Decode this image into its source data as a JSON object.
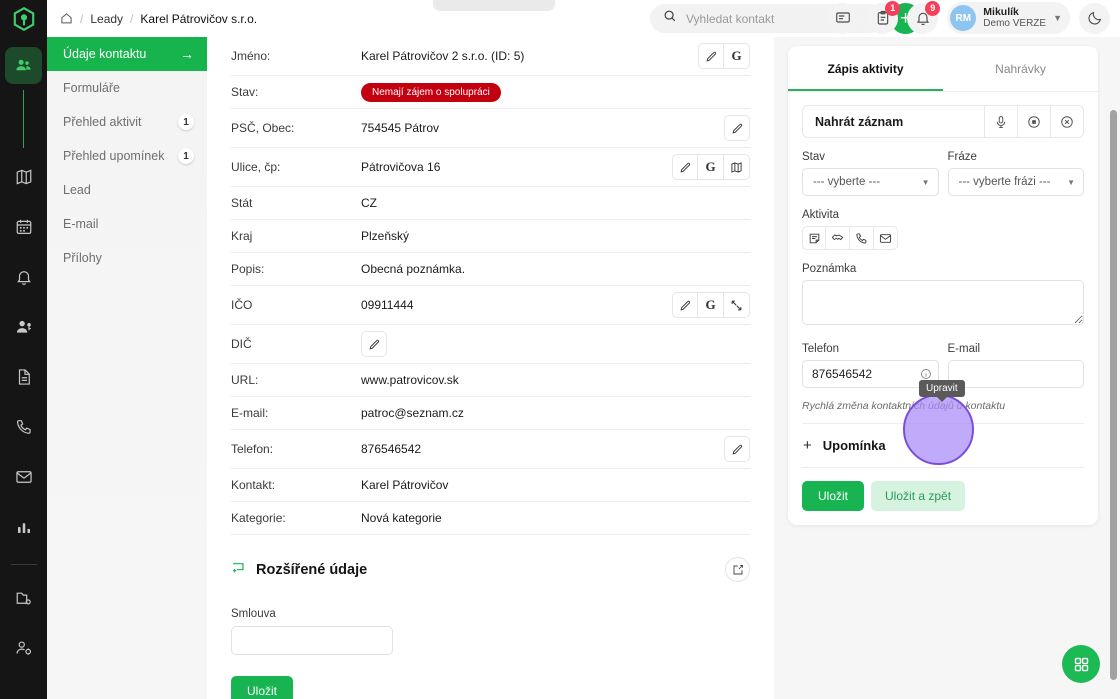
{
  "topbar": {
    "breadcrumb": {
      "home_icon": "home-icon",
      "items": [
        "Leady",
        "Karel Pátrovičov s.r.o."
      ],
      "separator": "/"
    },
    "search": {
      "placeholder": "Vyhledat kontakt",
      "value": "",
      "icon": "search-icon"
    },
    "add_button_label": "+",
    "actions": [
      {
        "name": "chat-icon",
        "badge": ""
      },
      {
        "name": "clipboard-icon",
        "badge": "1"
      },
      {
        "name": "bell-icon",
        "badge": "9"
      }
    ],
    "user": {
      "initials": "RM",
      "name": "Mikulík",
      "subtitle": "Demo VERZE"
    },
    "theme_toggle_icon": "moon-icon"
  },
  "rail": {
    "logo_icon": "app-logo-icon",
    "items": [
      {
        "name": "contacts-icon",
        "active": true
      },
      {
        "name": "map-icon",
        "active": false
      },
      {
        "name": "calendar-icon",
        "active": false
      },
      {
        "name": "bell-icon",
        "active": false
      },
      {
        "name": "user-key-icon",
        "active": false
      },
      {
        "name": "document-icon",
        "active": false
      },
      {
        "name": "phone-icon",
        "active": false
      },
      {
        "name": "mail-icon",
        "active": false
      },
      {
        "name": "chart-icon",
        "active": false
      },
      {
        "name": "folder-settings-icon",
        "active": false
      },
      {
        "name": "user-settings-icon",
        "active": false
      }
    ]
  },
  "subnav": {
    "items": [
      {
        "label": "Údaje kontaktu",
        "active": true,
        "badge": "",
        "arrow": "→"
      },
      {
        "label": "Formuláře",
        "active": false,
        "badge": ""
      },
      {
        "label": "Přehled aktivit",
        "active": false,
        "badge": "1"
      },
      {
        "label": "Přehled upomínek",
        "active": false,
        "badge": "1"
      },
      {
        "label": "Lead",
        "active": false,
        "badge": ""
      },
      {
        "label": "E-mail",
        "active": false,
        "badge": ""
      },
      {
        "label": "Přílohy",
        "active": false,
        "badge": ""
      }
    ]
  },
  "detail": {
    "rows": [
      {
        "label": "Jméno:",
        "value": "Karel Pátrovičov 2 s.r.o. (ID: 5)",
        "type": "text",
        "actions": [
          "edit-icon",
          "google-icon"
        ]
      },
      {
        "label": "Stav:",
        "value": "Nemají zájem o spolupráci",
        "type": "badge",
        "badge_color": "#c30010",
        "actions": []
      },
      {
        "label": "PSČ, Obec:",
        "value": "754545 Pátrov",
        "type": "text",
        "actions": [
          "edit-icon"
        ]
      },
      {
        "label": "Ulice, čp:",
        "value": "Pátrovičova 16",
        "type": "text",
        "actions": [
          "edit-icon",
          "google-icon",
          "map-icon"
        ]
      },
      {
        "label": "Stát",
        "value": "CZ",
        "type": "text",
        "actions": []
      },
      {
        "label": "Kraj",
        "value": "Plzeňský",
        "type": "text",
        "actions": []
      },
      {
        "label": "Popis:",
        "value": "Obecná poznámka.",
        "type": "text",
        "actions": []
      },
      {
        "label": "IČO",
        "value": "09911444",
        "type": "text",
        "actions": [
          "edit-icon",
          "google-icon",
          "ares-icon"
        ]
      },
      {
        "label": "DIČ",
        "value": "",
        "type": "text",
        "actions": [
          "edit-icon"
        ]
      },
      {
        "label": "URL:",
        "value": "www.patrovicov.sk",
        "type": "text",
        "actions": []
      },
      {
        "label": "E-mail:",
        "value": "patroc@seznam.cz",
        "type": "text",
        "actions": []
      },
      {
        "label": "Telefon:",
        "value": "876546542",
        "type": "text",
        "actions": [
          "edit-icon"
        ]
      },
      {
        "label": "Kontakt:",
        "value": "Karel Pátrovičov",
        "type": "text",
        "actions": []
      },
      {
        "label": "Kategorie:",
        "value": "Nová kategorie",
        "type": "text",
        "actions": []
      }
    ],
    "extended": {
      "title": "Rozšířené údaje",
      "title_icon": "add-field-icon",
      "edit_icon": "edit-square-icon",
      "field_label": "Smlouva",
      "field_value": "",
      "save_label": "Uložit"
    }
  },
  "activity": {
    "tabs": [
      {
        "label": "Zápis aktivity",
        "active": true
      },
      {
        "label": "Nahrávky",
        "active": false
      }
    ],
    "record": {
      "title": "Nahrát záznam",
      "buttons": [
        "microphone-icon",
        "stop-icon",
        "cancel-icon"
      ]
    },
    "state": {
      "label": "Stav",
      "value": "--- vyberte ---"
    },
    "phrase": {
      "label": "Fráze",
      "value": "--- vyberte frázi ---"
    },
    "activity_type": {
      "label": "Aktivita",
      "icons": [
        "note-icon",
        "handshake-icon",
        "phone-icon",
        "mail-icon"
      ]
    },
    "note": {
      "label": "Poznámka",
      "value": ""
    },
    "phone": {
      "label": "Telefon",
      "value": "876546542",
      "info_icon": "info-icon"
    },
    "email": {
      "label": "E-mail",
      "value": ""
    },
    "hint": "Rychlá změna kontaktních údajů u kontaktu",
    "reminder": {
      "label": "Upomínka",
      "plus": "+"
    },
    "save_label": "Uložit",
    "save_back_label": "Uložit a zpět"
  },
  "overlay": {
    "tooltip": "Upravit",
    "cursor_icon": "click-indicator"
  },
  "fab": {
    "icon": "grid-icon"
  },
  "colors": {
    "brand_green": "#19b452",
    "status_red": "#c30010",
    "accent_purple": "#a78bfa",
    "rail_dark": "#151515"
  }
}
